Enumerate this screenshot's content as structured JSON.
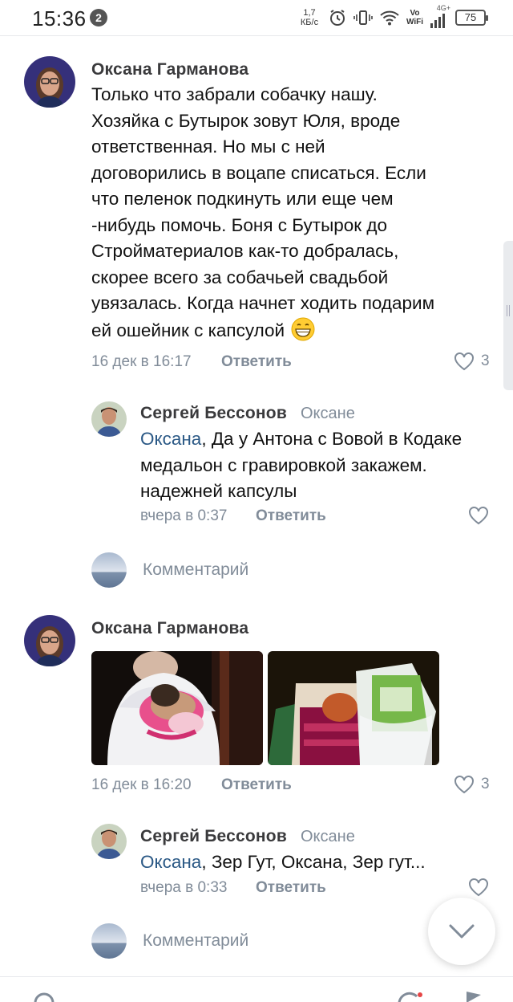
{
  "status_bar": {
    "time": "15:36",
    "notification_count": "2",
    "net_speed_value": "1,7",
    "net_speed_unit": "КБ/с",
    "vowifi_top": "Vo",
    "vowifi_bottom": "WiFi",
    "network_type": "4G+",
    "battery": "75"
  },
  "comments": [
    {
      "author": "Оксана Гарманова",
      "text": "Только что забрали собачку нашу. Хозяйка с Бутырок зовут Юля, вроде ответственная. Но мы с ней договорились в воцапе списаться. Если что пеленок подкинуть или еще чем -нибудь помочь. Боня с Бутырок до Стройматериалов как-то добралась, скорее всего за собачьей свадьбой увязалась. Когда начнет ходить подарим ей ошейник с капсулой",
      "time": "16 дек в 16:17",
      "reply_label": "Ответить",
      "likes": "3",
      "reply": {
        "author": "Сергей Бессонов",
        "reply_to": "Оксане",
        "mention": "Оксана",
        "text": ", Да у Антона с Вовой в Кодаке медальон с гравировкой закажем. надежней капсулы",
        "time": "вчера в 0:37",
        "reply_label": "Ответить"
      },
      "comment_placeholder": "Комментарий"
    },
    {
      "author": "Оксана Гарманова",
      "time": "16 дек в 16:20",
      "reply_label": "Ответить",
      "likes": "3",
      "reply": {
        "author": "Сергей Бессонов",
        "reply_to": "Оксане",
        "mention": "Оксана",
        "text": ", Зер Гут, Оксана, Зер гут...",
        "time": "вчера в 0:33",
        "reply_label": "Ответить"
      },
      "comment_placeholder": "Комментарий"
    }
  ],
  "colors": {
    "link": "#2a5885",
    "secondary_text": "#818c99",
    "author_text": "#3a3a3c"
  },
  "icons": [
    "heart-icon",
    "emoji-grin-icon",
    "chevron-down-icon"
  ]
}
